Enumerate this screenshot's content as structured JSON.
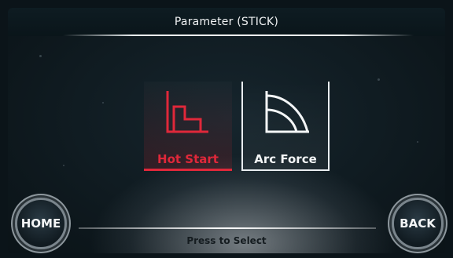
{
  "header": {
    "title": "Parameter (STICK)"
  },
  "options": [
    {
      "label": "Hot Start",
      "icon": "hot-start-icon",
      "selected": true,
      "color": "#e0283a"
    },
    {
      "label": "Arc Force",
      "icon": "arc-force-icon",
      "selected": false,
      "color": "#f4f6f7"
    }
  ],
  "nav": {
    "home_label": "HOME",
    "back_label": "BACK"
  },
  "footer": {
    "hint": "Press to Select"
  },
  "colors": {
    "accent": "#e0283a",
    "background": "#0d171c",
    "text": "#f2f4f5"
  }
}
